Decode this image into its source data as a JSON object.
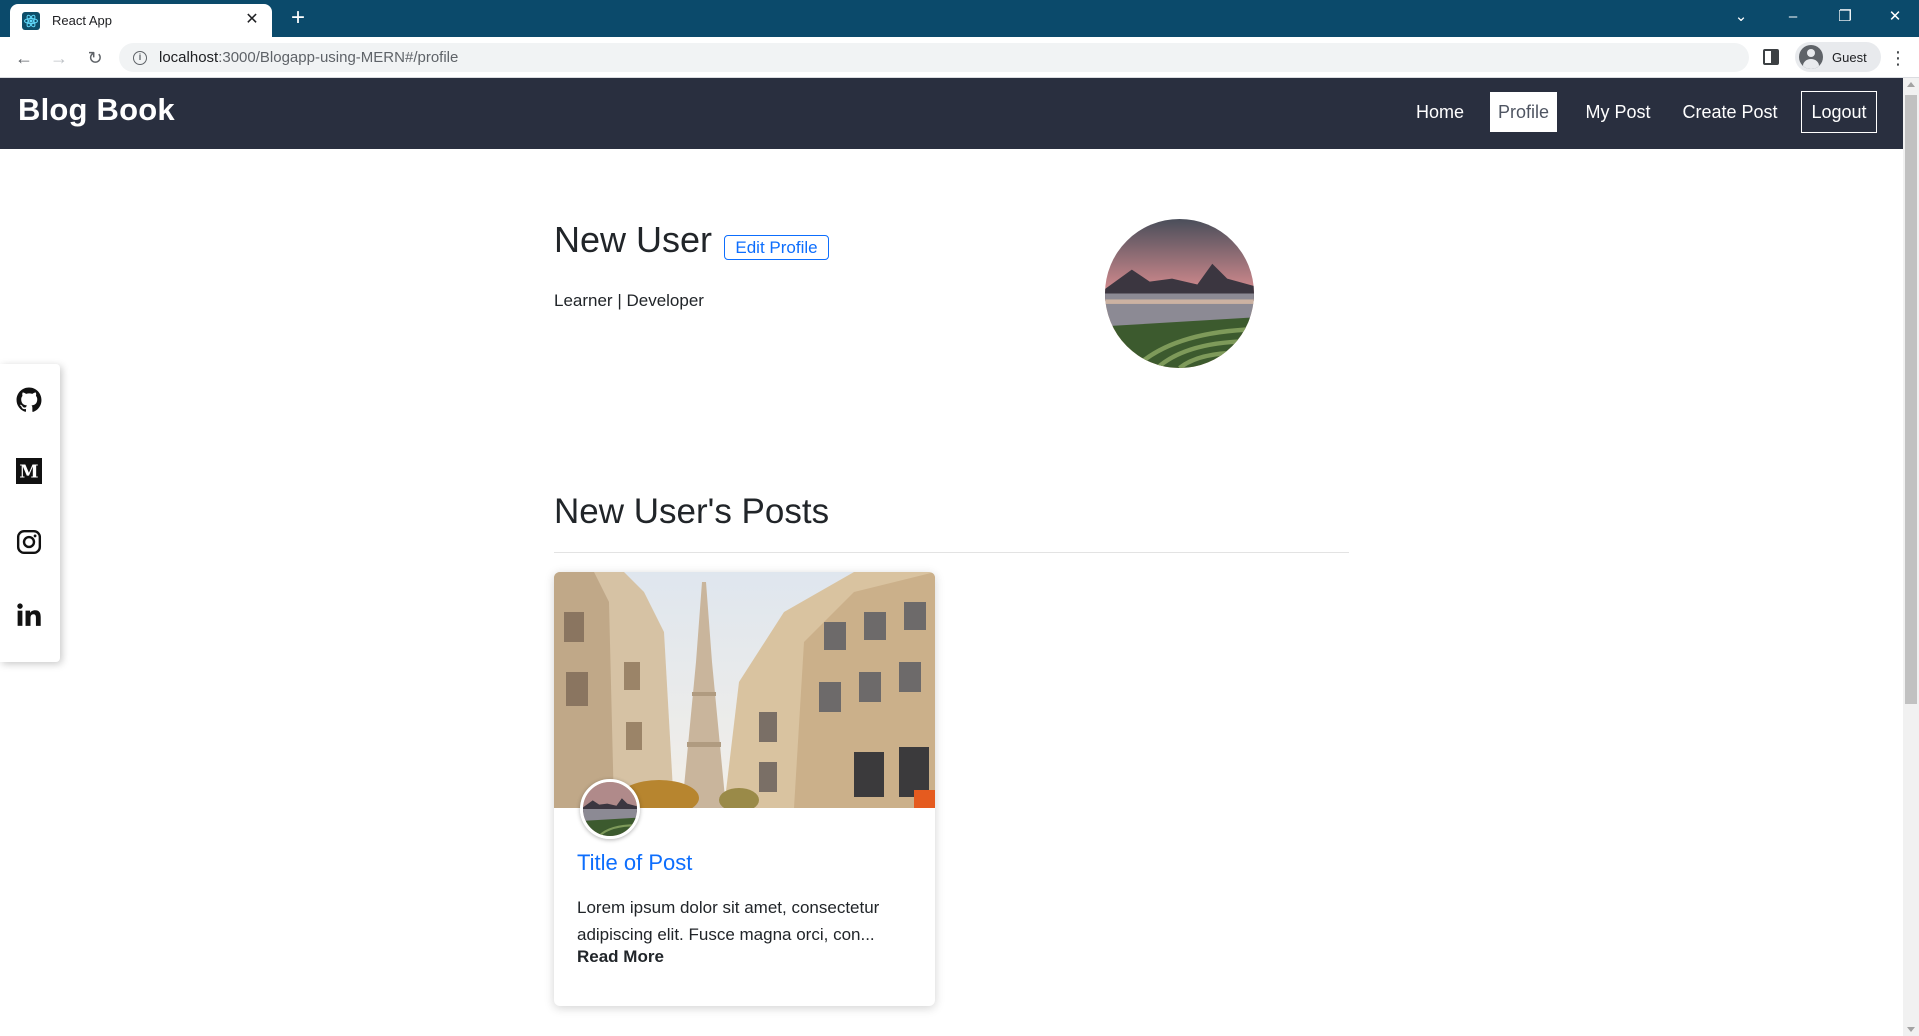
{
  "browser": {
    "tab_title": "React App",
    "url_host": "localhost",
    "url_rest": ":3000/Blogapp-using-MERN#/profile",
    "profile_label": "Guest"
  },
  "navbar": {
    "brand": "Blog Book",
    "links": [
      {
        "label": "Home",
        "active": false
      },
      {
        "label": "Profile",
        "active": true
      },
      {
        "label": "My Post",
        "active": false
      },
      {
        "label": "Create Post",
        "active": false
      },
      {
        "label": "Logout",
        "active": false
      }
    ]
  },
  "social": [
    "github-icon",
    "medium-icon",
    "instagram-icon",
    "linkedin-icon"
  ],
  "profile": {
    "name": "New User",
    "edit_label": "Edit Profile",
    "bio": "Learner | Developer"
  },
  "posts": {
    "heading": "New User's Posts",
    "items": [
      {
        "title": "Title of Post",
        "excerpt": "Lorem ipsum dolor sit amet, consectetur adipiscing elit. Fusce magna orci, con...",
        "read_more": "Read More"
      }
    ]
  },
  "colors": {
    "titlebar": "#0b4a6b",
    "navbar": "#292f3f",
    "link_blue": "#0d6efd"
  }
}
